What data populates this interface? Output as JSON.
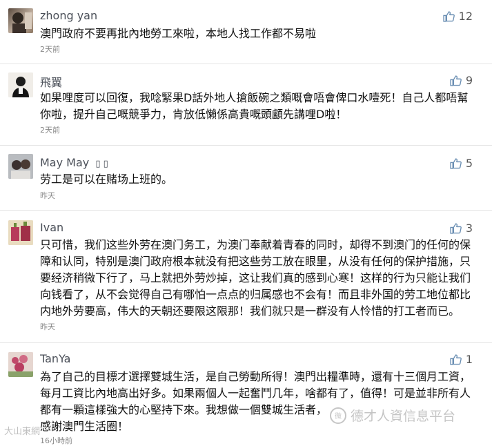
{
  "comments": [
    {
      "name": "zhong yan",
      "likes": "12",
      "lines": [
        "澳門政府不要再批內地勞工來啦，本地人找工作都不易啦"
      ],
      "time": "2天前"
    },
    {
      "name": "飛翼",
      "likes": "9",
      "lines": [
        "如果哩度可以回復，我唸緊果D話外地人搶飯碗之類嘅會唔會俾口水噎死！自己人都唔幫",
        "你啦，提升自己嘅競爭力，肯放低懶係高貴嘅頭顱先講哩D啦！"
      ],
      "time": "2天前"
    },
    {
      "name": "May May",
      "name_suffix": "▯ ▯",
      "likes": "5",
      "lines": [
        "劳工是可以在赌场上班的。"
      ],
      "time": "昨天"
    },
    {
      "name": "Ivan",
      "likes": "3",
      "lines": [
        "只可惜，我们这些外劳在澳门务工，为澳门奉献着青春的同时，却得不到澳门的任何的保",
        "障和认同，特别是澳门政府根本就没有把这些劳工放在眼里，从没有任何的保护措施，只",
        "要经济稍微下行了，马上就把外劳炒掉，这让我们真的感到心寒！这样的行为只能让我们",
        "向钱看了，从不会觉得自己有哪怕一点点的归属感也不会有！而且非外国的劳工地位都比",
        "内地外劳要高，伟大的天朝还要限这限那！我们就只是一群没有人怜惜的打工者而已。"
      ],
      "time": "昨天"
    },
    {
      "name": "TanYa",
      "likes": "1",
      "lines": [
        "為了自己的目標才選擇雙城生活，是自己勞動所得！澳門出糧準時，還有十三個月工資，",
        "每月工資比內地高出好多。如果兩個人一起奮鬥几年，啥都有了，值得！可是並非所有人",
        "都有一顆這樣強大的心堅持下來。我想做一個雙城生活者，",
        "感謝澳門生活圈！"
      ],
      "time": "16小時前"
    }
  ],
  "watermark": {
    "logo_text": "微",
    "text": "德才人資信息平台",
    "left_text": "大山東網"
  },
  "colors": {
    "name": "#4a4f58",
    "like_icon": "#6b8fb3",
    "time": "#888888"
  },
  "icons": {
    "like": "thumbs-up-icon",
    "avatar": "user-avatar"
  }
}
